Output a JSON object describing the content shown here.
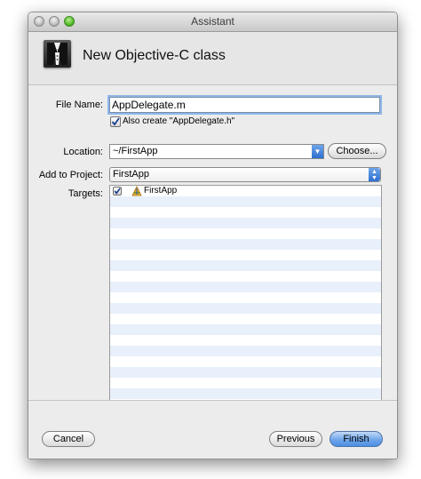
{
  "window": {
    "title": "Assistant"
  },
  "header": {
    "title": "New Objective-C class",
    "icon": "xcode-tuxedo-icon"
  },
  "form": {
    "file_name_label": "File Name:",
    "file_name_value": "AppDelegate.m",
    "also_create_label": "Also create \"AppDelegate.h\"",
    "also_create_checked": true,
    "location_label": "Location:",
    "location_value": "~/FirstApp",
    "choose_button": "Choose...",
    "add_to_project_label": "Add to Project:",
    "add_to_project_value": "FirstApp",
    "targets_label": "Targets:",
    "targets": [
      {
        "name": "FirstApp",
        "checked": true,
        "icon": "app-target-icon"
      }
    ]
  },
  "footer": {
    "cancel": "Cancel",
    "previous": "Previous",
    "finish": "Finish"
  },
  "colors": {
    "accent": "#4c8ee3",
    "focus_ring": "#8fb6ea",
    "row_stripe": "#e8f0fb"
  }
}
